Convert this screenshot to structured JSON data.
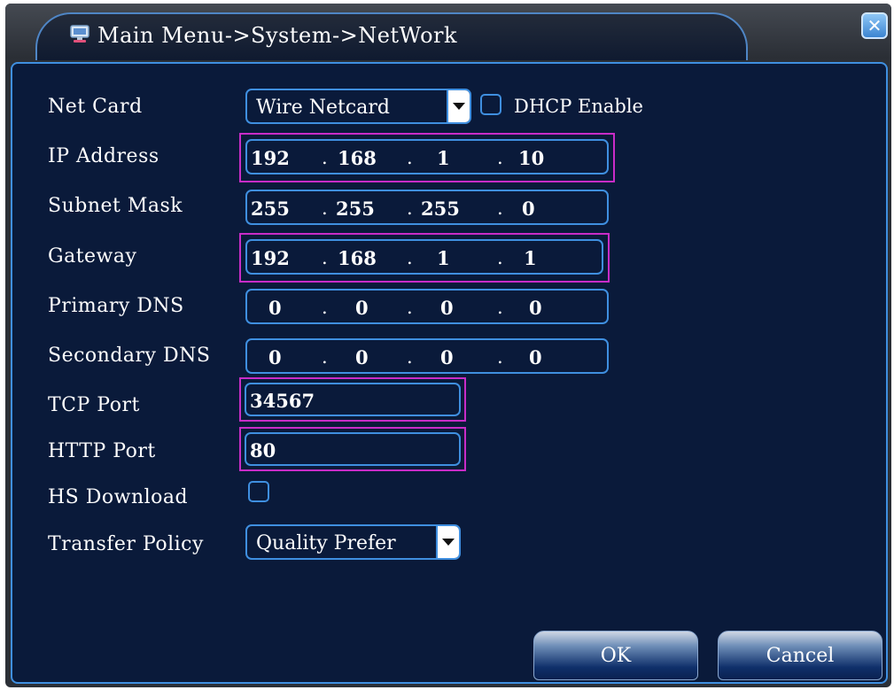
{
  "window": {
    "title": "Main Menu->System->NetWork",
    "close_glyph": "✕"
  },
  "net_card": {
    "label": "Net Card",
    "value": "Wire Netcard",
    "dhcp_label": "DHCP Enable",
    "dhcp_checked": false
  },
  "ip_address": {
    "label": "IP Address",
    "octets": [
      "192",
      "168",
      "1",
      "10"
    ]
  },
  "subnet_mask": {
    "label": "Subnet Mask",
    "octets": [
      "255",
      "255",
      "255",
      "0"
    ]
  },
  "gateway": {
    "label": "Gateway",
    "octets": [
      "192",
      "168",
      "1",
      "1"
    ]
  },
  "primary_dns": {
    "label": "Primary DNS",
    "octets": [
      "0",
      "0",
      "0",
      "0"
    ]
  },
  "secondary_dns": {
    "label": "Secondary DNS",
    "octets": [
      "0",
      "0",
      "0",
      "0"
    ]
  },
  "tcp_port": {
    "label": "TCP Port",
    "value": "34567"
  },
  "http_port": {
    "label": "HTTP Port",
    "value": "80"
  },
  "hs_download": {
    "label": "HS Download",
    "checked": false
  },
  "transfer_policy": {
    "label": "Transfer Policy",
    "value": "Quality Prefer"
  },
  "buttons": {
    "ok": "OK",
    "cancel": "Cancel"
  },
  "colors": {
    "panel_bg": "#0a1a3a",
    "field_border": "#3f8fe0",
    "highlight_border": "#c82cc8",
    "text": "#ffffff"
  },
  "icons": {
    "title": "network-settings-icon",
    "close": "close-icon"
  }
}
